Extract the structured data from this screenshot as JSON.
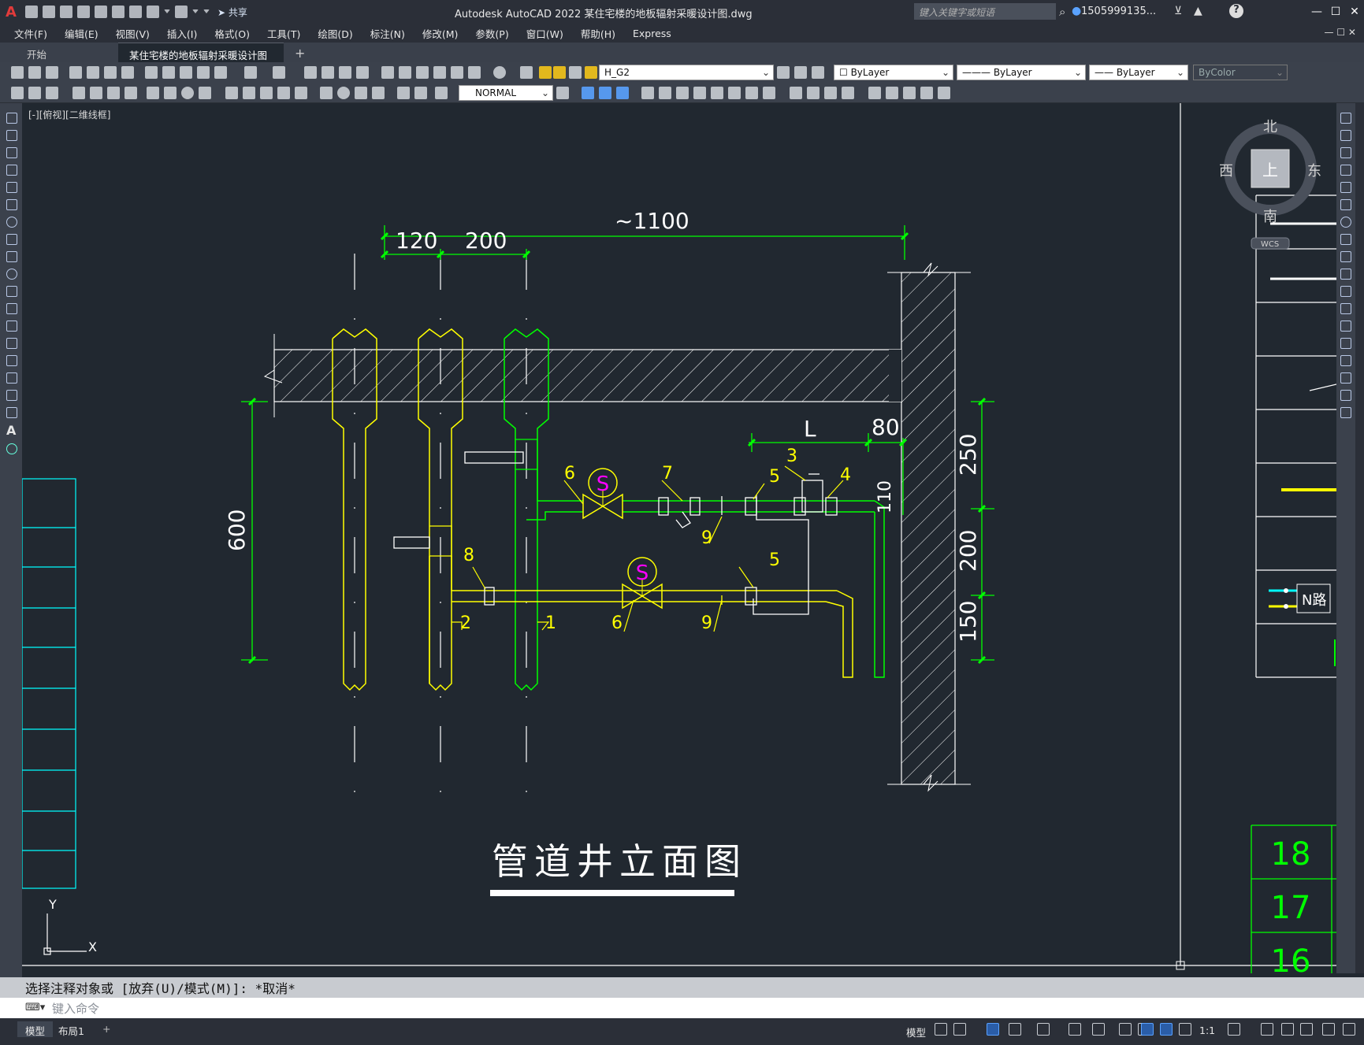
{
  "app": {
    "logo": "A",
    "title": "Autodesk AutoCAD 2022    某住宅楼的地板辐射采暖设计图.dwg",
    "share_label": "共享",
    "search_placeholder": "键入关键字或短语",
    "user": "1505999135...",
    "help": "?"
  },
  "menu": [
    "文件(F)",
    "编辑(E)",
    "视图(V)",
    "插入(I)",
    "格式(O)",
    "工具(T)",
    "绘图(D)",
    "标注(N)",
    "修改(M)",
    "参数(P)",
    "窗口(W)",
    "帮助(H)",
    "Express"
  ],
  "tabs": {
    "start": "开始",
    "doc": "某住宅楼的地板辐射采暖设计图*",
    "close": "✕",
    "add": "+"
  },
  "toolbar": {
    "layer": "H_G2",
    "color": "ByLayer",
    "linetype": "ByLayer",
    "lineweight": "ByLayer",
    "plotstyle": "ByColor",
    "textstyle": "NORMAL"
  },
  "viewport": {
    "label": "[-][俯视][二维线框]"
  },
  "viewcube": {
    "north": "北",
    "south": "南",
    "east": "东",
    "west": "西",
    "top": "上",
    "wcs": "WCS"
  },
  "drawing": {
    "title": "管道井立面图",
    "dims": {
      "total": "~1100",
      "d120": "120",
      "d200": "200",
      "d600": "600",
      "dL": "L",
      "d80": "80",
      "d250": "250",
      "d200v": "200",
      "d150": "150",
      "d110": "110"
    },
    "labels": [
      "6",
      "7",
      "5",
      "3",
      "4",
      "9",
      "8",
      "6",
      "5",
      "9",
      "2",
      "1"
    ],
    "valve_symbol": "S",
    "legend_numbers": [
      "18",
      "17",
      "16"
    ],
    "n_label": "N路",
    "ucs_x": "X",
    "ucs_y": "Y"
  },
  "command": {
    "history": "选择注释对象或 [放弃(U)/模式(M)]: *取消*",
    "placeholder": "键入命令"
  },
  "status": {
    "tab_model": "模型",
    "tab_layout": "布局1",
    "tab_add": "+",
    "model_label": "模型",
    "scale": "1:1"
  },
  "colors": {
    "background": "#212830",
    "dimension_green": "#00ff00",
    "pipe_yellow": "#ffff00",
    "valve_magenta": "#ff00ff",
    "grid_cyan": "#00ffff",
    "line_white": "#ffffff"
  }
}
